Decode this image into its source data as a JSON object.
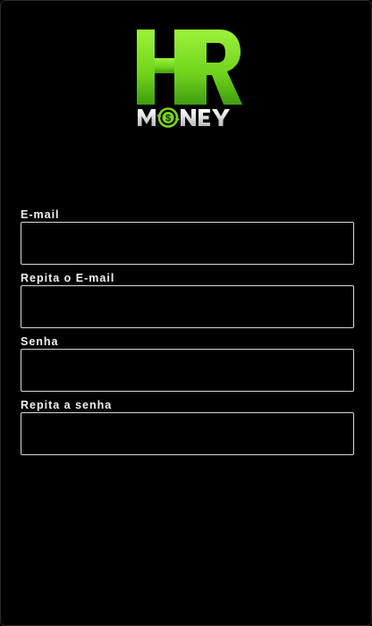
{
  "logo": {
    "top_text": "HR",
    "bottom_text": "MONEY",
    "icon": "dollar-refresh-icon",
    "accent_color": "#7ed321"
  },
  "form": {
    "fields": [
      {
        "label": "E-mail",
        "value": "",
        "placeholder": ""
      },
      {
        "label": "Repita o E-mail",
        "value": "",
        "placeholder": ""
      },
      {
        "label": "Senha",
        "value": "",
        "placeholder": ""
      },
      {
        "label": "Repita a senha",
        "value": "",
        "placeholder": ""
      }
    ]
  }
}
